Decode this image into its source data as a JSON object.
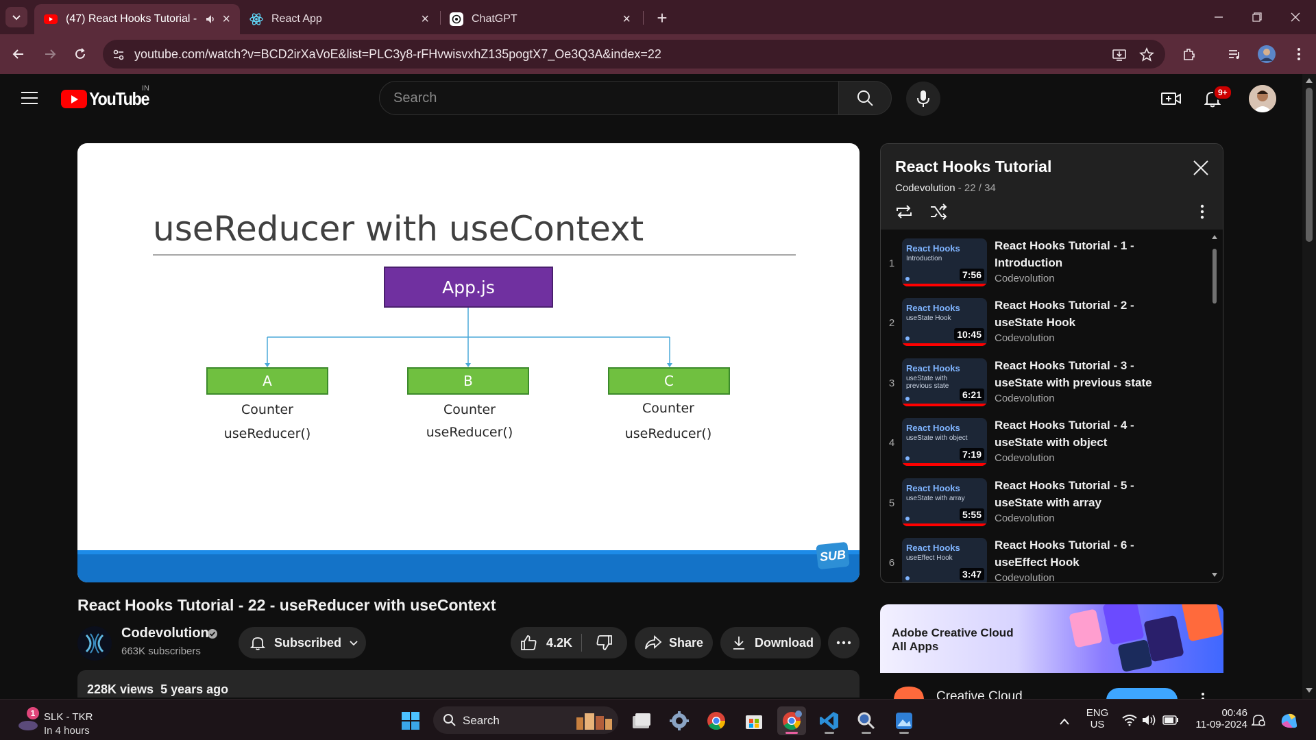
{
  "browser": {
    "tabs": [
      {
        "title": "(47) React Hooks Tutorial -",
        "icon": "youtube-icon",
        "active": true
      },
      {
        "title": "React App",
        "icon": "react-icon",
        "active": false
      },
      {
        "title": "ChatGPT",
        "icon": "chatgpt-icon",
        "active": false
      }
    ],
    "new_tab": "+",
    "url": "youtube.com/watch?v=BCD2irXaVoE&list=PLC3y8-rFHvwisvxhZ135pogtX7_Oe3Q3A&index=22"
  },
  "youtube": {
    "logo_text": "YouTube",
    "region": "IN",
    "search_placeholder": "Search",
    "notifications": "9+"
  },
  "slide": {
    "title": "useReducer with useContext",
    "root": "App.js",
    "children": [
      {
        "label": "A",
        "line1": "Counter",
        "line2": "useReducer()"
      },
      {
        "label": "B",
        "line1": "Counter",
        "line2": "useReducer()"
      },
      {
        "label": "C",
        "line1": "Counter",
        "line2": "useReducer()"
      }
    ],
    "badge": "SUB"
  },
  "video": {
    "title": "React Hooks Tutorial - 22 - useReducer with useContext",
    "channel": "Codevolution",
    "subscribers": "663K subscribers",
    "subscribed_label": "Subscribed",
    "likes": "4.2K",
    "share_label": "Share",
    "download_label": "Download",
    "views": "228K views",
    "age": "5 years ago"
  },
  "playlist": {
    "title": "React Hooks Tutorial",
    "channel": "Codevolution",
    "position": "- 22 / 34",
    "items": [
      {
        "index": "1",
        "thumb_title": "React Hooks",
        "thumb_sub": "Introduction",
        "duration": "7:56",
        "title": "React Hooks Tutorial - 1 - Introduction",
        "channel": "Codevolution"
      },
      {
        "index": "2",
        "thumb_title": "React Hooks",
        "thumb_sub": "useState Hook",
        "duration": "10:45",
        "title": "React Hooks Tutorial - 2 - useState Hook",
        "channel": "Codevolution"
      },
      {
        "index": "3",
        "thumb_title": "React Hooks",
        "thumb_sub": "useState with previous state",
        "duration": "6:21",
        "title": "React Hooks Tutorial - 3 - useState with previous state",
        "channel": "Codevolution"
      },
      {
        "index": "4",
        "thumb_title": "React Hooks",
        "thumb_sub": "useState with object",
        "duration": "7:19",
        "title": "React Hooks Tutorial - 4 - useState with object",
        "channel": "Codevolution"
      },
      {
        "index": "5",
        "thumb_title": "React Hooks",
        "thumb_sub": "useState with array",
        "duration": "5:55",
        "title": "React Hooks Tutorial - 5 - useState with array",
        "channel": "Codevolution"
      },
      {
        "index": "6",
        "thumb_title": "React Hooks",
        "thumb_sub": "useEffect Hook",
        "duration": "3:47",
        "title": "React Hooks Tutorial - 6 - useEffect Hook",
        "channel": "Codevolution"
      }
    ]
  },
  "ad": {
    "headline_1": "Adobe Creative Cloud",
    "headline_2": "All Apps",
    "advertiser": "Creative Cloud"
  },
  "taskbar": {
    "notification_count": "1",
    "weather_title": "SLK - TKR",
    "weather_sub": "In 4 hours",
    "search_label": "Search",
    "lang_1": "ENG",
    "lang_2": "US",
    "time": "00:46",
    "date": "11-09-2024"
  },
  "colors": {
    "tab_bar": "#3c1b27",
    "address_bar": "#5a2b3a",
    "yt_red": "#ff0000",
    "slide_root": "#7030a0",
    "slide_child": "#70c040",
    "slide_bar": "#1473c8"
  }
}
